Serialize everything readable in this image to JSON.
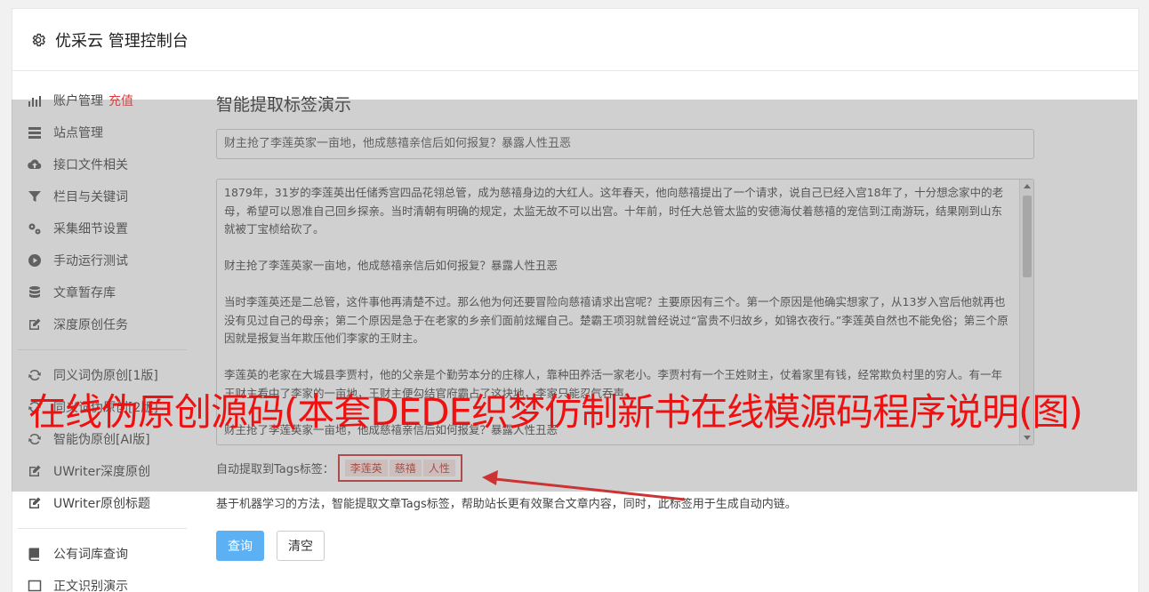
{
  "header": {
    "title": "优采云 管理控制台"
  },
  "sidebar": {
    "group1": [
      {
        "label": "账户管理",
        "badge": "充值",
        "icon": "bar-chart-icon"
      },
      {
        "label": "站点管理",
        "icon": "list-icon"
      },
      {
        "label": "接口文件相关",
        "icon": "cloud-upload-icon"
      },
      {
        "label": "栏目与关键词",
        "icon": "filter-icon"
      },
      {
        "label": "采集细节设置",
        "icon": "gears-icon"
      },
      {
        "label": "手动运行测试",
        "icon": "play-icon"
      },
      {
        "label": "文章暂存库",
        "icon": "database-icon"
      },
      {
        "label": "深度原创任务",
        "icon": "edit-icon"
      }
    ],
    "group2": [
      {
        "label": "同义词伪原创[1版]",
        "icon": "refresh-icon"
      },
      {
        "label": "同义词伪原创[2版]",
        "icon": "refresh-icon"
      },
      {
        "label": "智能伪原创[AI版]",
        "icon": "refresh-icon"
      },
      {
        "label": "UWriter深度原创",
        "icon": "edit-icon"
      },
      {
        "label": "UWriter原创标题",
        "icon": "edit-icon"
      }
    ],
    "group3": [
      {
        "label": "公有词库查询",
        "icon": "book-icon"
      },
      {
        "label": "正文识别演示",
        "icon": "square-icon"
      }
    ]
  },
  "main": {
    "heading": "智能提取标签演示",
    "title_value": "财主抢了李莲英家一亩地，他成慈禧亲信后如何报复？暴露人性丑恶",
    "article": "1879年，31岁的李莲英出任储秀宫四品花翎总管，成为慈禧身边的大红人。这年春天，他向慈禧提出了一个请求，说自己已经入宫18年了，十分想念家中的老母，希望可以恩准自己回乡探亲。当时清朝有明确的规定，太监无故不可以出宫。十年前，时任大总管太监的安德海仗着慈禧的宠信到江南游玩，结果刚到山东就被丁宝桢给砍了。\n\n财主抢了李莲英家一亩地，他成慈禧亲信后如何报复？暴露人性丑恶\n\n当时李莲英还是二总管，这件事他再清楚不过。那么他为何还要冒险向慈禧请求出宫呢？主要原因有三个。第一个原因是他确实想家了，从13岁入宫后他就再也没有见过自己的母亲；第二个原因是急于在老家的乡亲们面前炫耀自己。楚霸王项羽就曾经说过“富贵不归故乡，如锦衣夜行。”李莲英自然也不能免俗；第三个原因就是报复当年欺压他们李家的王财主。\n\n李莲英的老家在大城县李贾村，他的父亲是个勤劳本分的庄稼人，靠种田养活一家老小。李贾村有一个王姓财主，仗着家里有钱，经常欺负村里的穷人。有一年王财主看中了李家的一亩地，王财主便勾结官府霸占了这块地，李家只能忍气吞声。\n\n财主抢了李莲英家一亩地，他成慈禧亲信后如何报复？暴露人性丑恶",
    "tags_label": "自动提取到Tags标签：",
    "tags": [
      "李莲英",
      "慈禧",
      "人性"
    ],
    "description": "基于机器学习的方法，智能提取文章Tags标签，帮助站长更有效聚合文章内容，同时，此标签用于生成自动内链。",
    "query_button": "查询",
    "clear_button": "清空"
  },
  "watermark": "在线伪原创源码(本套DEDE织梦仿制新书在线模源码程序说明(图)",
  "colors": {
    "accent": "#5bb1f4",
    "badge": "#e4393c",
    "tag_border": "#cc3333",
    "watermark": "#ee1111"
  }
}
